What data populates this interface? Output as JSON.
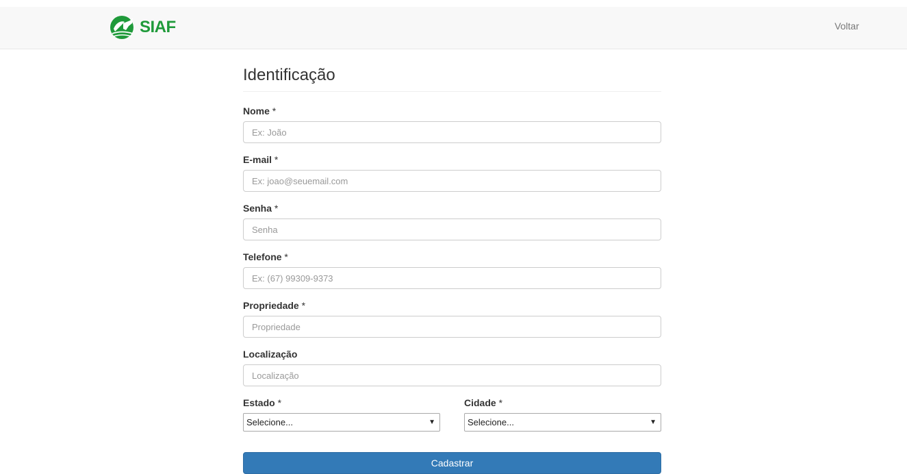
{
  "brand": {
    "name": "SIAF",
    "logo_icon": "leaf-bull-logo-icon",
    "color": "#1f9a3a"
  },
  "nav": {
    "back_label": "Voltar"
  },
  "form": {
    "title": "Identificação",
    "required_mark": "*",
    "fields": [
      {
        "label": "Nome",
        "required": true,
        "placeholder": "Ex: João",
        "value": ""
      },
      {
        "label": "E-mail",
        "required": true,
        "placeholder": "Ex: joao@seuemail.com",
        "value": ""
      },
      {
        "label": "Senha",
        "required": true,
        "placeholder": "Senha",
        "value": ""
      },
      {
        "label": "Telefone",
        "required": true,
        "placeholder": "Ex: (67) 99309-9373",
        "value": ""
      },
      {
        "label": "Propriedade",
        "required": true,
        "placeholder": "Propriedade",
        "value": ""
      },
      {
        "label": "Localização",
        "required": false,
        "placeholder": "Localização",
        "value": ""
      }
    ],
    "estado": {
      "label": "Estado",
      "selected": "Selecione..."
    },
    "cidade": {
      "label": "Cidade",
      "selected": "Selecione..."
    },
    "submit_label": "Cadastrar"
  },
  "colors": {
    "primary_button": "#337ab7",
    "navbar_bg": "#f8f8f8"
  }
}
